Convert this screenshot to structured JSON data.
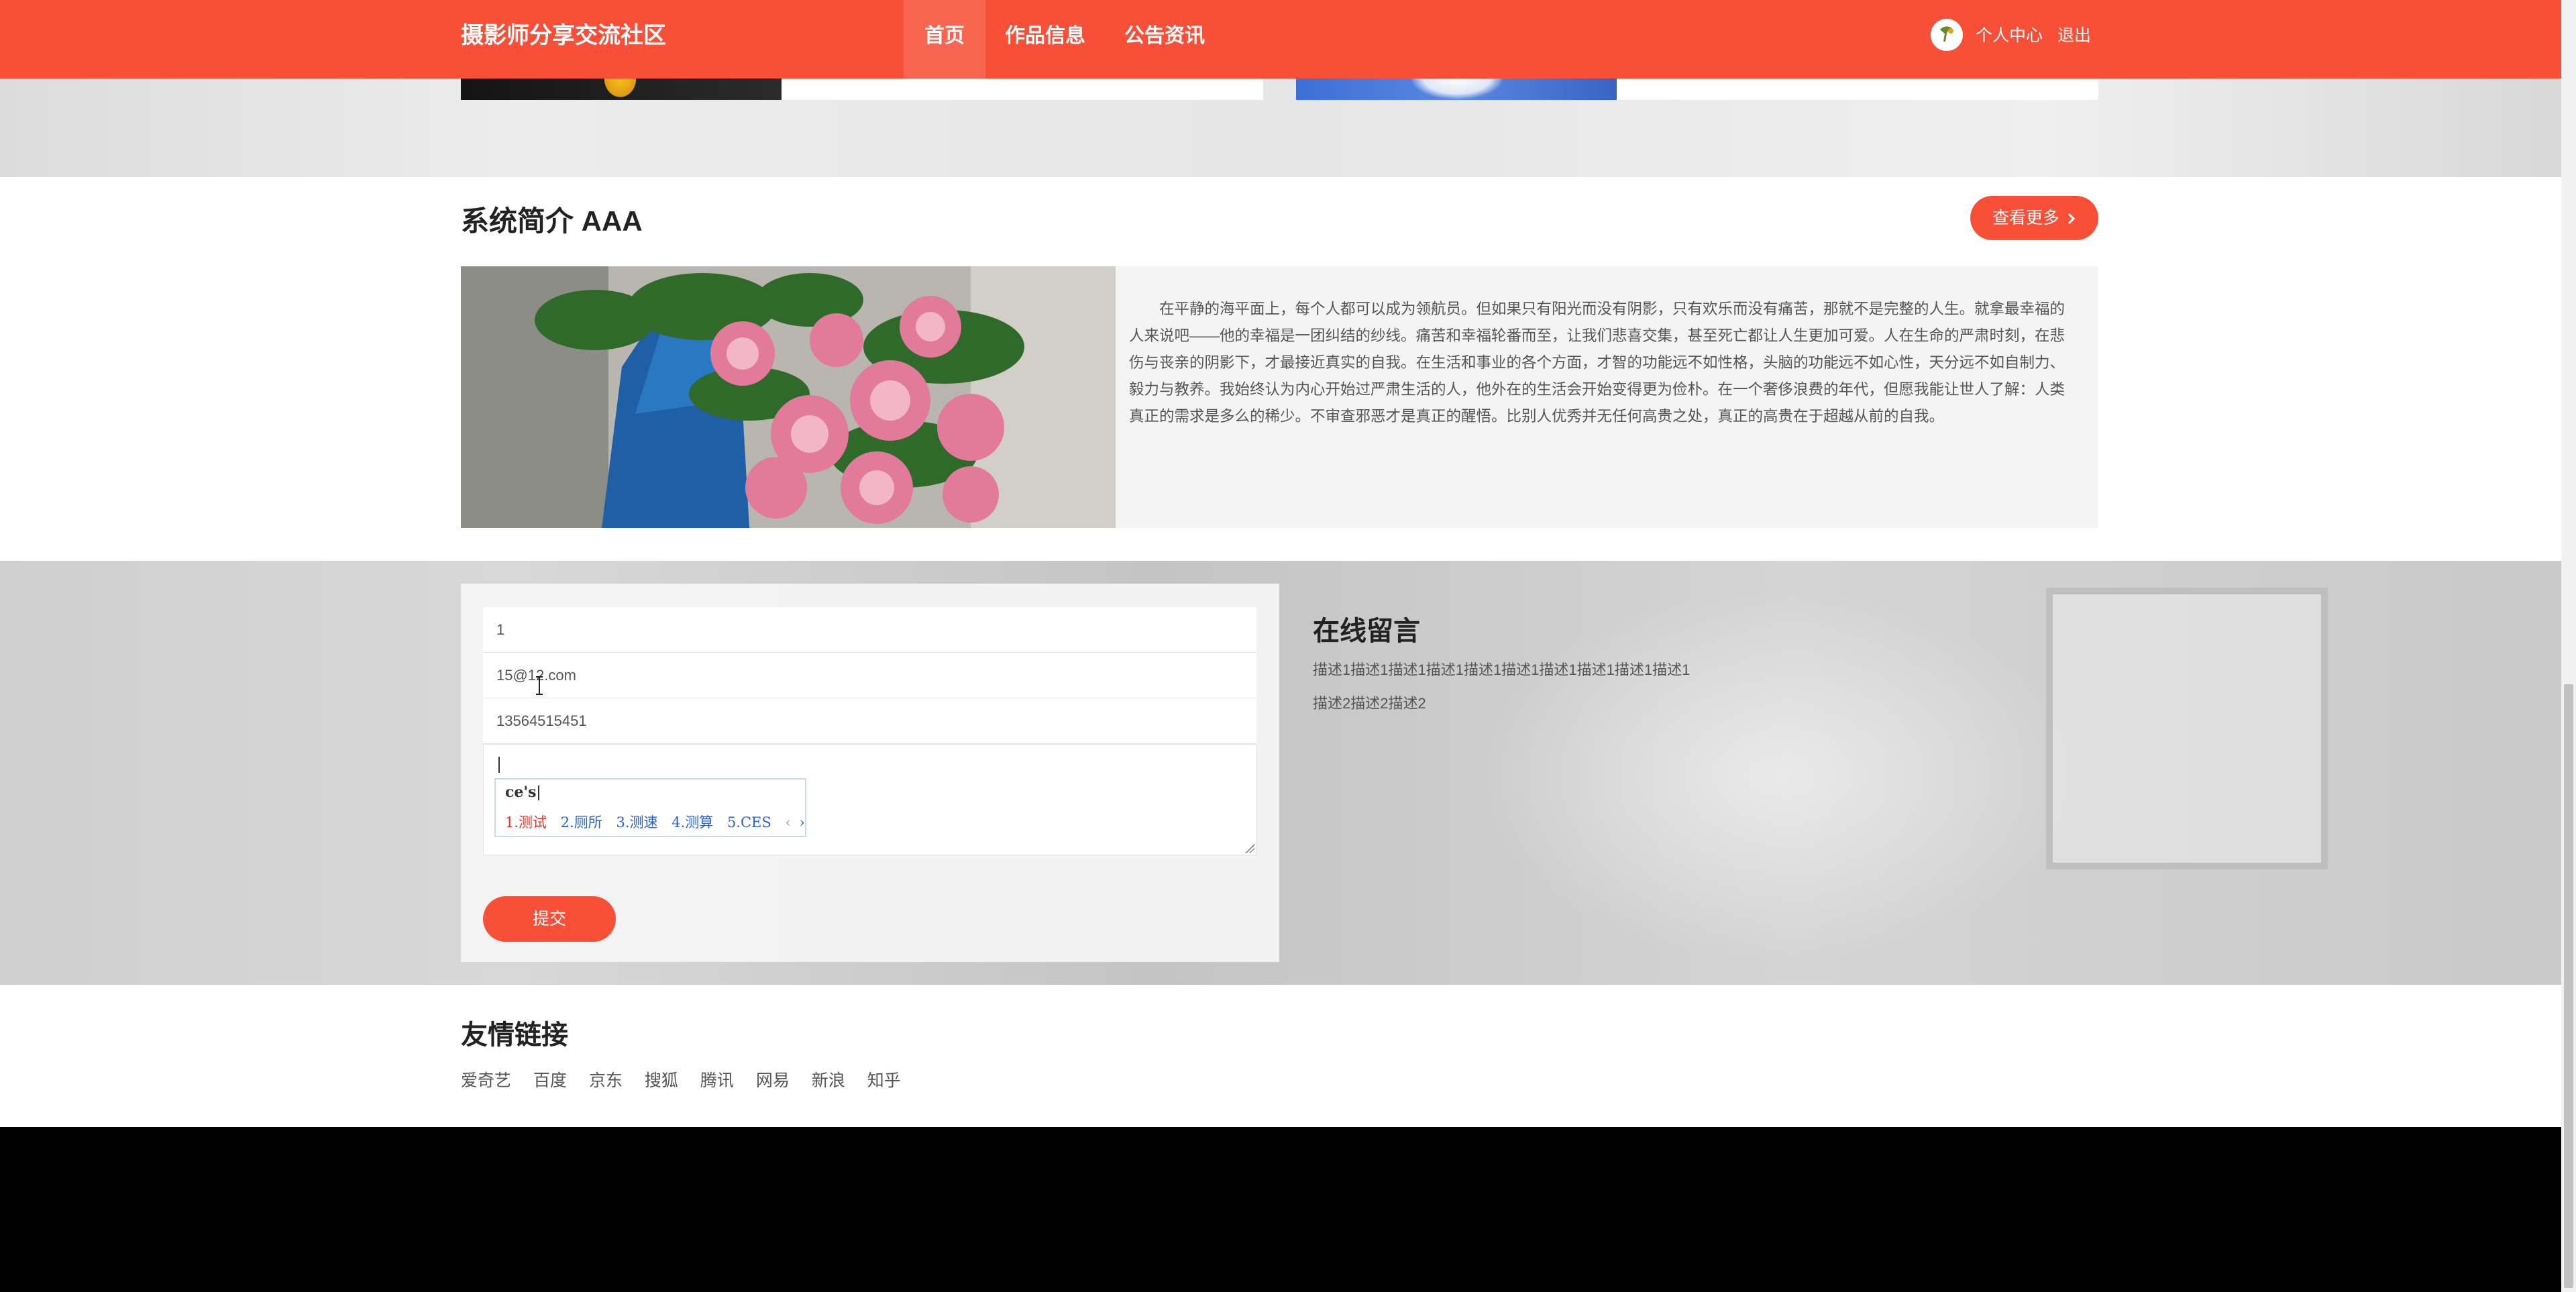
{
  "navbar": {
    "brand": "摄影师分享交流社区",
    "items": [
      {
        "label": "首页",
        "active": true
      },
      {
        "label": "作品信息",
        "active": false
      },
      {
        "label": "公告资讯",
        "active": false
      }
    ],
    "user_center": "个人中心",
    "logout": "退出",
    "accent_color": "#f85038"
  },
  "intro": {
    "title": "系统简介 AAA",
    "more_label": "查看更多",
    "text": "在平静的海平面上，每个人都可以成为领航员。但如果只有阳光而没有阴影，只有欢乐而没有痛苦，那就不是完整的人生。就拿最幸福的人来说吧——他的幸福是一团纠结的纱线。痛苦和幸福轮番而至，让我们悲喜交集，甚至死亡都让人生更加可爱。人在生命的严肃时刻，在悲伤与丧亲的阴影下，才最接近真实的自我。在生活和事业的各个方面，才智的功能远不如性格，头脑的功能远不如心性，天分远不如自制力、毅力与教养。我始终认为内心开始过严肃生活的人，他外在的生活会开始变得更为俭朴。在一个奢侈浪费的年代，但愿我能让世人了解：人类真正的需求是多么的稀少。不审查邪恶才是真正的醒悟。比别人优秀并无任何高贵之处，真正的高贵在于超越从前的自我。"
  },
  "message_form": {
    "name_value": "1",
    "email_value": "15@12.com",
    "phone_value": "13564515451",
    "content_value": "",
    "ime": {
      "composition": "ce's",
      "candidates": [
        "1.测试",
        "2.厕所",
        "3.测速",
        "4.测算",
        "5.CES"
      ],
      "prev": "‹",
      "next": "›"
    },
    "submit_label": "提交"
  },
  "message_info": {
    "title": "在线留言",
    "desc1": "描述1描述1描述1描述1描述1描述1描述1描述1描述1描述1",
    "desc2": "描述2描述2描述2"
  },
  "links": {
    "title": "友情链接",
    "items": [
      "爱奇艺",
      "百度",
      "京东",
      "搜狐",
      "腾讯",
      "网易",
      "新浪",
      "知乎"
    ]
  }
}
